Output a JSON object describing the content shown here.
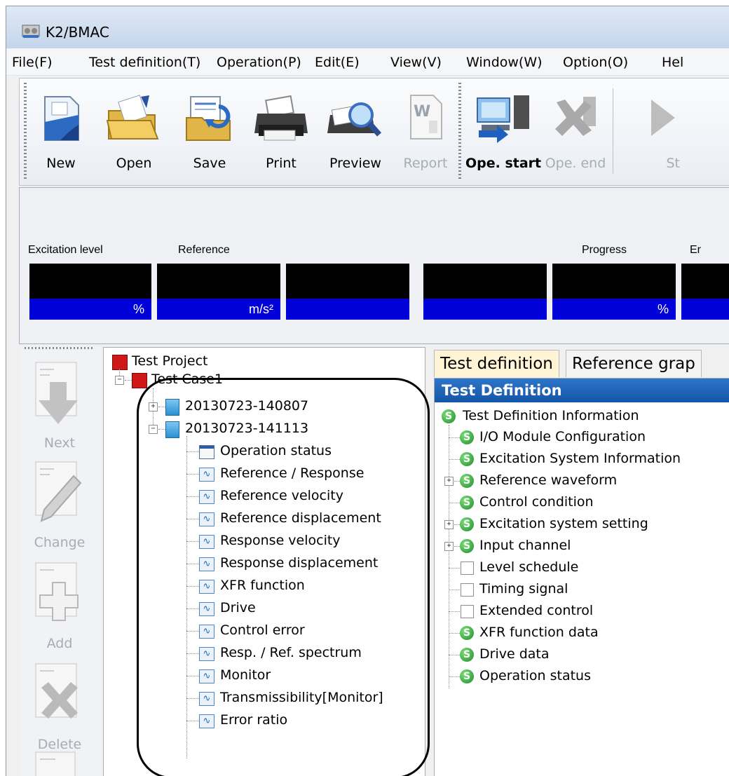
{
  "window": {
    "title": "K2/BMAC"
  },
  "menu": [
    "File(F)",
    "Test definition(T)",
    "Operation(P)",
    "Edit(E)",
    "View(V)",
    "Window(W)",
    "Option(O)",
    "Hel"
  ],
  "toolbar": {
    "new": "New",
    "open": "Open",
    "save": "Save",
    "print": "Print",
    "preview": "Preview",
    "report": "Report",
    "ope_start": "Ope. start",
    "ope_end": "Ope. end",
    "start": "St"
  },
  "status": {
    "excitation_level": "Excitation level",
    "reference": "Reference",
    "progress": "Progress",
    "error": "Er",
    "excitation_unit": "%",
    "reference_unit": "m/s²",
    "progress_unit": "%"
  },
  "sidebar": {
    "next": "Next",
    "change": "Change",
    "add": "Add",
    "delete": "Delete"
  },
  "project_tree": {
    "project": "Test Project",
    "case": "Test Case1",
    "runs": [
      "20130723-140807",
      "20130723-141113"
    ],
    "items": [
      "Operation status",
      "Reference / Response",
      "Reference velocity",
      "Reference displacement",
      "Response velocity",
      "Response displacement",
      "XFR function",
      "Drive",
      "Control error",
      "Resp. / Ref. spectrum",
      "Monitor",
      "Transmissibility[Monitor]",
      "Error ratio"
    ]
  },
  "tabs": {
    "test_definition": "Test definition",
    "reference_graph": "Reference grap"
  },
  "definition": {
    "header": "Test Definition",
    "root": "Test Definition Information",
    "items": [
      "I/O Module Configuration",
      "Excitation System Information",
      "Reference waveform",
      "Control condition",
      "Excitation system setting",
      "Input channel",
      "Level schedule",
      "Timing signal",
      "Extended control",
      "XFR function data",
      "Drive data",
      "Operation status"
    ]
  }
}
